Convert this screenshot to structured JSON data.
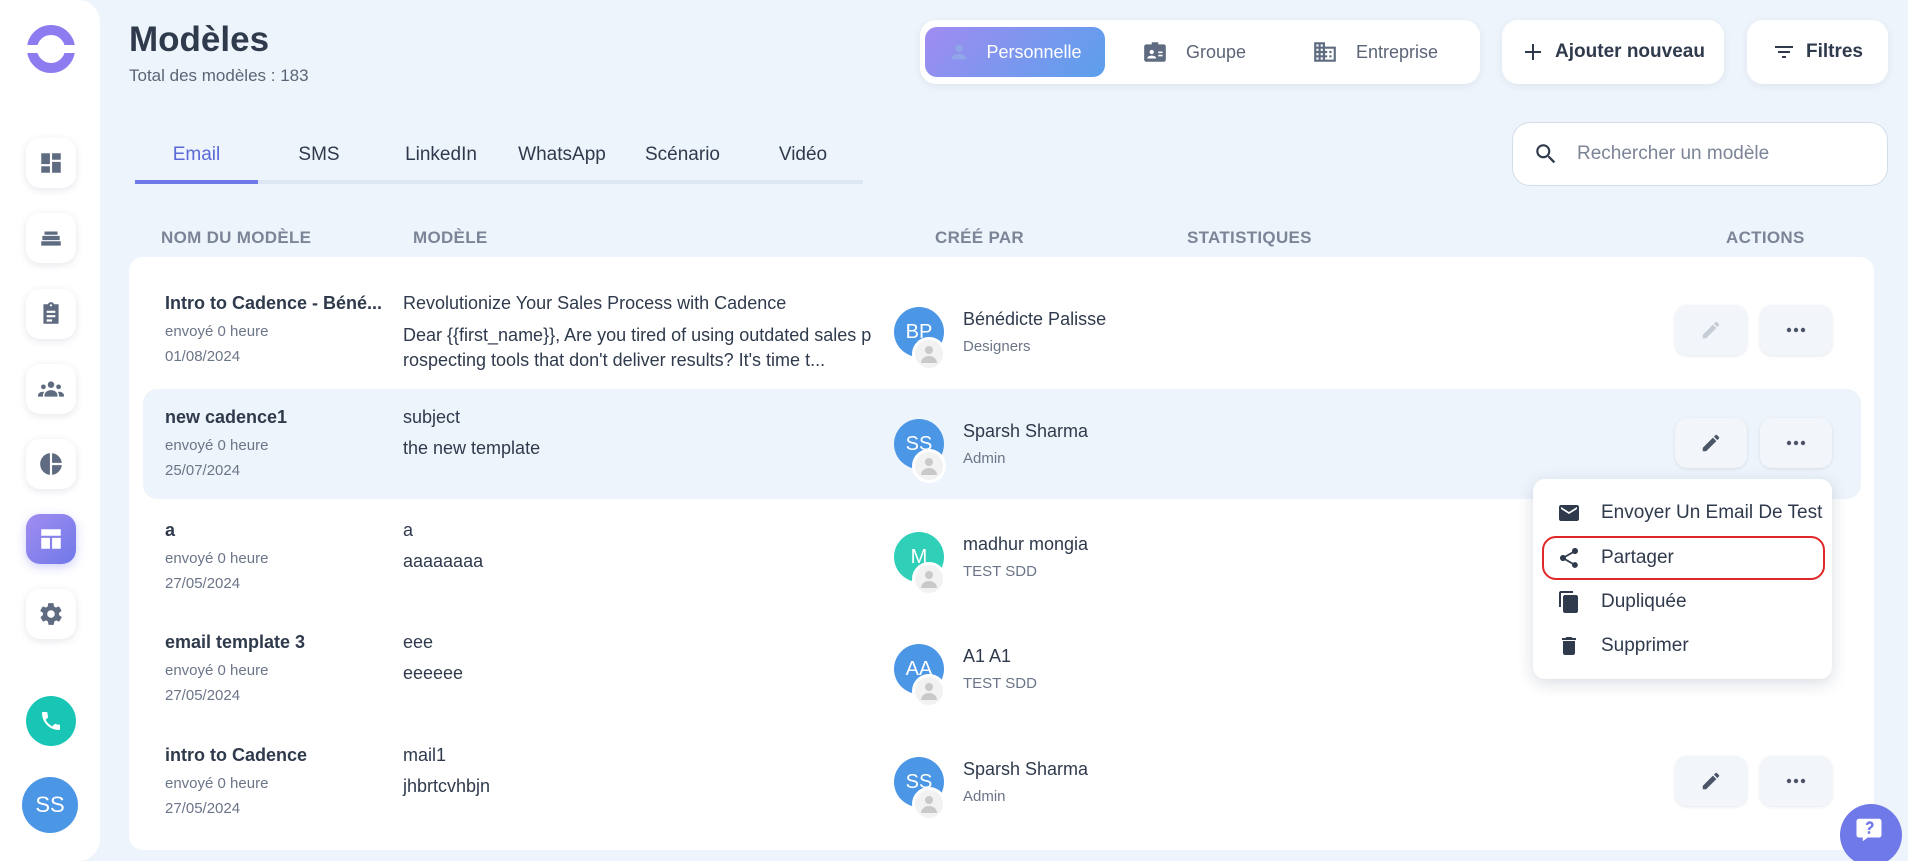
{
  "header": {
    "title": "Modèles",
    "subtitle": "Total des modèles : 183"
  },
  "segment": {
    "items": [
      {
        "label": "Personnelle",
        "icon": "person-icon",
        "active": true
      },
      {
        "label": "Groupe",
        "icon": "id-card-icon",
        "active": false
      },
      {
        "label": "Entreprise",
        "icon": "building-icon",
        "active": false
      }
    ]
  },
  "actions": {
    "add_label": "Ajouter nouveau",
    "filter_label": "Filtres"
  },
  "tabs": [
    {
      "label": "Email",
      "active": true
    },
    {
      "label": "SMS"
    },
    {
      "label": "LinkedIn"
    },
    {
      "label": "WhatsApp"
    },
    {
      "label": "Scénario"
    },
    {
      "label": "Vidéo"
    }
  ],
  "search": {
    "placeholder": "Rechercher un modèle"
  },
  "table": {
    "columns": [
      "NOM DU MODÈLE",
      "MODÈLE",
      "CRÉÉ PAR",
      "STATISTIQUES",
      "ACTIONS"
    ],
    "rows": [
      {
        "name": "Intro to Cadence - Béné...",
        "sent": "envoyé 0 heure",
        "date": "01/08/2024",
        "subject": "Revolutionize Your Sales Process with Cadence",
        "body": "Dear {{first_name}},   Are you tired of using outdated sales prospecting tools that don't deliver results? It's time t...",
        "initials": "BP",
        "creator": "Bénédicte Palisse",
        "group": "Designers"
      },
      {
        "name": "new cadence1",
        "sent": "envoyé 0 heure",
        "date": "25/07/2024",
        "subject": "subject",
        "body": "the new template",
        "initials": "SS",
        "creator": "Sparsh Sharma",
        "group": "Admin"
      },
      {
        "name": "a",
        "sent": "envoyé 0 heure",
        "date": "27/05/2024",
        "subject": "a",
        "body": "aaaaaaaa",
        "initials": "M",
        "creator": "madhur mongia",
        "group": "TEST SDD"
      },
      {
        "name": "email template 3",
        "sent": "envoyé 0 heure",
        "date": "27/05/2024",
        "subject": "eee",
        "body": "eeeeee",
        "initials": "AA",
        "creator": "A1 A1",
        "group": "TEST SDD"
      },
      {
        "name": "intro to Cadence",
        "sent": "envoyé 0 heure",
        "date": "27/05/2024",
        "subject": "mail1",
        "body": "jhbrtcvhbjn",
        "initials": "SS",
        "creator": "Sparsh Sharma",
        "group": "Admin"
      }
    ]
  },
  "menu": {
    "items": [
      {
        "label": "Envoyer Un Email De Test",
        "icon": "mail-icon"
      },
      {
        "label": "Partager",
        "icon": "share-icon"
      },
      {
        "label": "Dupliquée",
        "icon": "copy-icon"
      },
      {
        "label": "Supprimer",
        "icon": "trash-icon"
      }
    ]
  },
  "user": {
    "initials": "SS"
  },
  "colors": {
    "accent": "#6f79e8",
    "teal": "#19c6b5",
    "avatar_blue": "#4b97e6",
    "highlight_red": "#e02828"
  }
}
